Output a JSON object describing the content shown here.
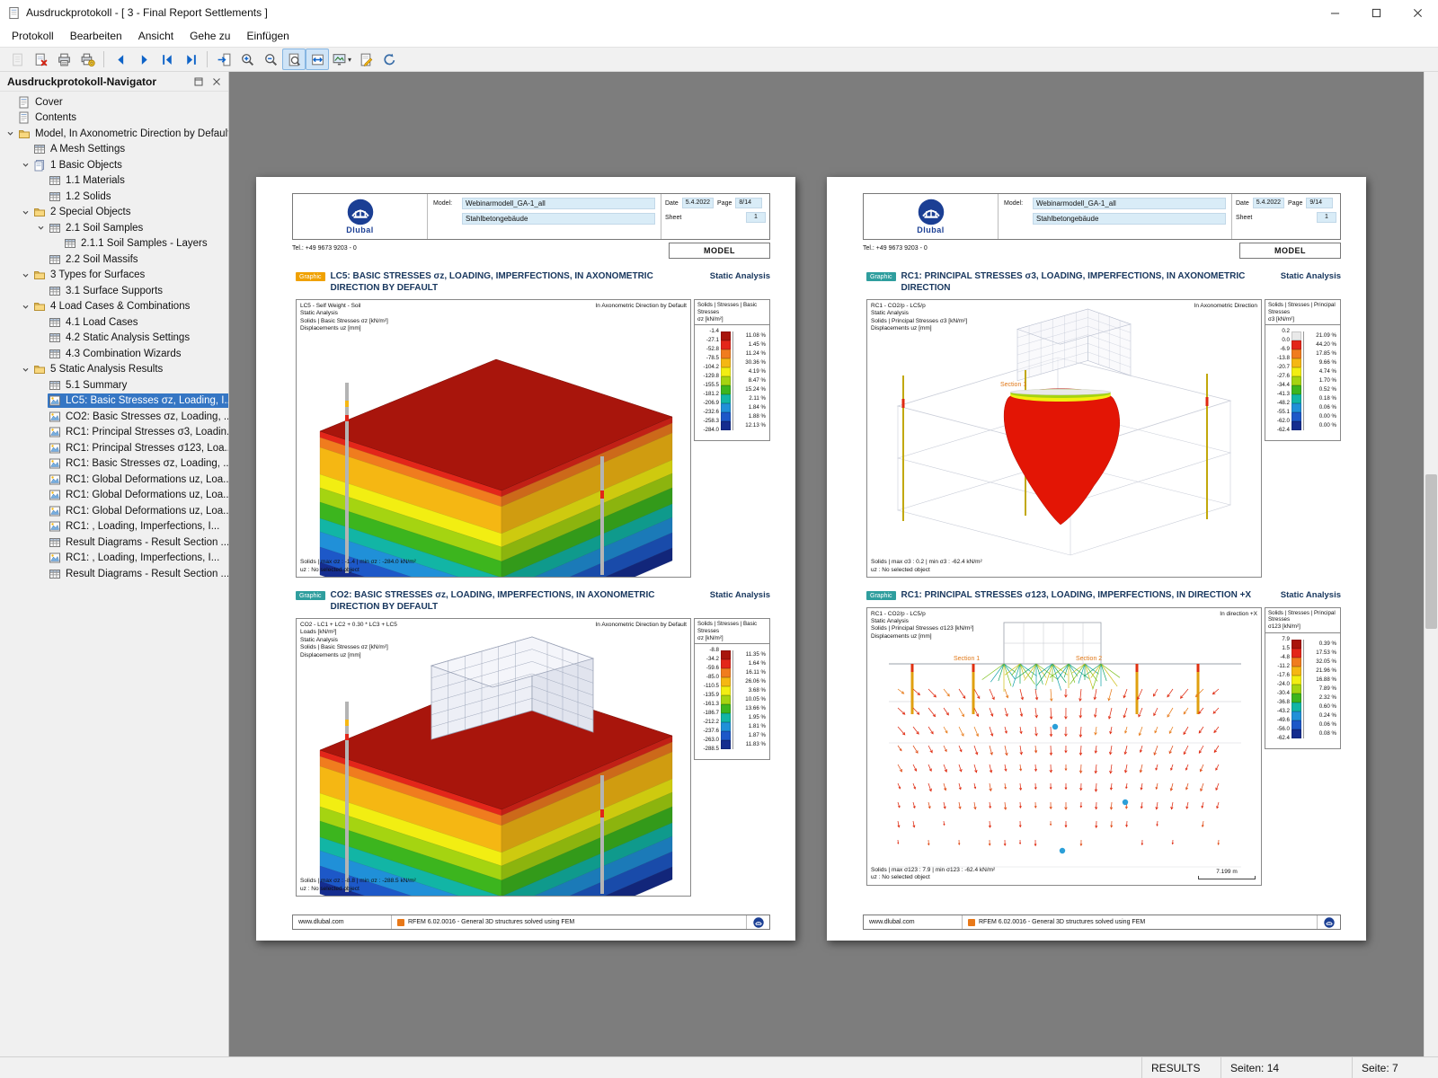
{
  "window": {
    "title": "Ausdruckprotokoll - [ 3 - Final Report Settlements ]"
  },
  "menu": [
    {
      "label": "Protokoll"
    },
    {
      "label": "Bearbeiten"
    },
    {
      "label": "Ansicht"
    },
    {
      "label": "Gehe zu"
    },
    {
      "label": "Einfügen"
    }
  ],
  "toolbar": [
    {
      "name": "new-page",
      "disabled": true
    },
    {
      "name": "delete-protocol"
    },
    {
      "name": "print"
    },
    {
      "name": "print-options"
    },
    {
      "name": "sep"
    },
    {
      "name": "nav-back"
    },
    {
      "name": "nav-forward"
    },
    {
      "name": "nav-first"
    },
    {
      "name": "nav-last"
    },
    {
      "name": "sep"
    },
    {
      "name": "goto-page"
    },
    {
      "name": "zoom-in"
    },
    {
      "name": "zoom-out"
    },
    {
      "name": "fit-page",
      "active": true
    },
    {
      "name": "fit-width",
      "active": true
    },
    {
      "name": "view-options",
      "dropdown": true
    },
    {
      "name": "edit-header"
    },
    {
      "name": "refresh"
    }
  ],
  "navigator": {
    "title": "Ausdruckprotokoll-Navigator",
    "items": [
      {
        "label": "Cover",
        "icon": "report",
        "level": 0
      },
      {
        "label": "Contents",
        "icon": "report",
        "level": 0
      },
      {
        "label": "Model, In Axonometric Direction by Default",
        "icon": "folder",
        "level": 0,
        "expanded": true
      },
      {
        "label": "A Mesh Settings",
        "icon": "table",
        "level": 1
      },
      {
        "label": "1 Basic Objects",
        "icon": "stack",
        "level": 1,
        "expanded": true
      },
      {
        "label": "1.1 Materials",
        "icon": "table",
        "level": 2
      },
      {
        "label": "1.2 Solids",
        "icon": "table",
        "level": 2
      },
      {
        "label": "2 Special Objects",
        "icon": "folder",
        "level": 1,
        "expanded": true
      },
      {
        "label": "2.1 Soil Samples",
        "icon": "table",
        "level": 2,
        "expanded": true
      },
      {
        "label": "2.1.1 Soil Samples - Layers",
        "icon": "table",
        "level": 3
      },
      {
        "label": "2.2 Soil Massifs",
        "icon": "table",
        "level": 2
      },
      {
        "label": "3 Types for Surfaces",
        "icon": "folder",
        "level": 1,
        "expanded": true
      },
      {
        "label": "3.1 Surface Supports",
        "icon": "table",
        "level": 2
      },
      {
        "label": "4 Load Cases & Combinations",
        "icon": "folder",
        "level": 1,
        "expanded": true
      },
      {
        "label": "4.1 Load Cases",
        "icon": "table",
        "level": 2
      },
      {
        "label": "4.2 Static Analysis Settings",
        "icon": "table",
        "level": 2
      },
      {
        "label": "4.3 Combination Wizards",
        "icon": "table",
        "level": 2
      },
      {
        "label": "5 Static Analysis Results",
        "icon": "folder",
        "level": 1,
        "expanded": true
      },
      {
        "label": "5.1 Summary",
        "icon": "table",
        "level": 2
      },
      {
        "label": "LC5: Basic Stresses σz, Loading, I...",
        "icon": "graphic",
        "level": 2,
        "selected": true
      },
      {
        "label": "CO2: Basic Stresses σz, Loading, ...",
        "icon": "graphic",
        "level": 2
      },
      {
        "label": "RC1: Principal Stresses σ3, Loadin...",
        "icon": "graphic",
        "level": 2
      },
      {
        "label": "RC1: Principal Stresses σ123, Loa...",
        "icon": "graphic",
        "level": 2
      },
      {
        "label": "RC1: Basic Stresses σz, Loading, ...",
        "icon": "graphic",
        "level": 2
      },
      {
        "label": "RC1: Global Deformations uz, Loa...",
        "icon": "graphic",
        "level": 2
      },
      {
        "label": "RC1: Global Deformations uz, Loa...",
        "icon": "graphic",
        "level": 2
      },
      {
        "label": "RC1: Global Deformations uz, Loa...",
        "icon": "graphic",
        "level": 2
      },
      {
        "label": "RC1: , Loading, Imperfections, I...",
        "icon": "graphic",
        "level": 2
      },
      {
        "label": "Result Diagrams - Result Section ...",
        "icon": "table",
        "level": 2
      },
      {
        "label": "RC1: , Loading, Imperfections, I...",
        "icon": "graphic",
        "level": 2
      },
      {
        "label": "Result Diagrams - Result Section ...",
        "icon": "table",
        "level": 2
      }
    ]
  },
  "preview": {
    "pages": [
      {
        "header": {
          "brand": "Dlubal",
          "model_label": "Model:",
          "model_name": "Webinarmodell_GA-1_all",
          "model_desc": "Stahlbetongebäude",
          "date_label": "Date",
          "date": "5.4.2022",
          "page_label": "Page",
          "page": "8/14",
          "sheet_label": "Sheet",
          "sheet": "1",
          "tel": "Tel.: +49 9673 9203 - 0",
          "doc_type": "MODEL"
        },
        "sections": [
          {
            "badge": "Graphic",
            "badge_color": "#f0a100",
            "title": "LC5: BASIC STRESSES σz, LOADING, IMPERFECTIONS, IN AXONOMETRIC DIRECTION BY DEFAULT",
            "analysis": "Static Analysis",
            "info": "LC5 - Self Weight - Soil\nStatic Analysis\nSolids | Basic Stresses σz [kN/m²]\nDisplacements uz [mm]",
            "view": "In Axonometric Direction by Default",
            "visual": "soil",
            "legend": {
              "title": "Solids | Stresses | Basic Stresses",
              "unit": "σz [kN/m²]",
              "values": [
                "-1.4",
                "-27.1",
                "-52.8",
                "-78.5",
                "-104.2",
                "-129.8",
                "-155.5",
                "-181.2",
                "-206.9",
                "-232.6",
                "-258.3",
                "-284.0"
              ],
              "percents": [
                "11.08 %",
                "1.45 %",
                "11.24 %",
                "30.36 %",
                "4.19 %",
                "8.47 %",
                "15.24 %",
                "2.11 %",
                "1.84 %",
                "1.88 %",
                "12.13 %"
              ],
              "colors": [
                "#a8150c",
                "#e3261a",
                "#f07c1e",
                "#f5b713",
                "#f2ee12",
                "#a5d411",
                "#3cb51e",
                "#12b5a5",
                "#2090d8",
                "#1d58c8",
                "#152d8f"
              ]
            },
            "result": "Solids | max σz : -1.4 | min σz : -284.0 kN/m²",
            "result2": "uz : No selected object"
          },
          {
            "badge": "Graphic",
            "badge_color": "#2f9e9e",
            "title": "CO2: BASIC STRESSES σz, LOADING, IMPERFECTIONS, IN AXONOMETRIC DIRECTION BY DEFAULT",
            "analysis": "Static Analysis",
            "info": "CO2 - LC1 + LC2 + 0.30 * LC3 + LC5\nLoads [kN/m²]\nStatic Analysis\nSolids | Basic Stresses σz [kN/m²]\nDisplacements uz [mm]",
            "view": "In Axonometric Direction by Default",
            "visual": "soil-building",
            "legend": {
              "title": "Solids | Stresses | Basic Stresses",
              "unit": "σz [kN/m²]",
              "values": [
                "-8.8",
                "-34.2",
                "-59.6",
                "-85.0",
                "-110.5",
                "-135.9",
                "-161.3",
                "-186.7",
                "-212.2",
                "-237.6",
                "-263.0",
                "-288.5"
              ],
              "percents": [
                "11.35 %",
                "1.64 %",
                "16.11 %",
                "26.06 %",
                "3.68 %",
                "10.05 %",
                "13.66 %",
                "1.95 %",
                "1.81 %",
                "1.87 %",
                "11.83 %"
              ],
              "colors": [
                "#a8150c",
                "#e3261a",
                "#f07c1e",
                "#f5b713",
                "#f2ee12",
                "#a5d411",
                "#3cb51e",
                "#12b5a5",
                "#2090d8",
                "#1d58c8",
                "#152d8f"
              ]
            },
            "result": "Solids | max σz : -8.8 | min σz : -288.5 kN/m²",
            "result2": "uz : No selected object"
          }
        ],
        "footer": {
          "url": "www.dlubal.com",
          "app": "RFEM 6.02.0016 - General 3D structures solved using FEM"
        }
      },
      {
        "header": {
          "brand": "Dlubal",
          "model_label": "Model:",
          "model_name": "Webinarmodell_GA-1_all",
          "model_desc": "Stahlbetongebäude",
          "date_label": "Date",
          "date": "5.4.2022",
          "page_label": "Page",
          "page": "9/14",
          "sheet_label": "Sheet",
          "sheet": "1",
          "tel": "Tel.: +49 9673 9203 - 0",
          "doc_type": "MODEL"
        },
        "sections": [
          {
            "badge": "Graphic",
            "badge_color": "#2f9e9e",
            "title": "RC1: PRINCIPAL STRESSES σ3, LOADING, IMPERFECTIONS, IN AXONOMETRIC DIRECTION",
            "analysis": "Static Analysis",
            "info": "RC1 - CO2/p - LC5/p\nStatic Analysis\nSolids | Principal Stresses σ3 [kN/m²]\nDisplacements uz [mm]",
            "view": "In Axonometric Direction",
            "visual": "blob",
            "annotations": [
              "Section 1"
            ],
            "legend": {
              "title": "Solids | Stresses | Principal Stresses",
              "unit": "σ3 [kN/m²]",
              "values": [
                "0.2",
                "0.0",
                "-6.9",
                "-13.8",
                "-20.7",
                "-27.6",
                "-34.4",
                "-41.3",
                "-48.2",
                "-55.1",
                "-62.0",
                "-62.4"
              ],
              "percents": [
                "21.09 %",
                "44.20 %",
                "17.85 %",
                "9.66 %",
                "4.74 %",
                "1.70 %",
                "0.52 %",
                "0.18 %",
                "0.06 %",
                "0.00 %",
                "0.00 %"
              ],
              "colors": [
                "#e9e9e9",
                "#e3261a",
                "#f07c1e",
                "#f5b713",
                "#f2ee12",
                "#a5d411",
                "#3cb51e",
                "#12b5a5",
                "#2090d8",
                "#1d58c8",
                "#152d8f"
              ]
            },
            "result": "Solids | max σ3 : 0.2 | min σ3 : -62.4 kN/m²",
            "result2": "uz : No selected object"
          },
          {
            "badge": "Graphic",
            "badge_color": "#2f9e9e",
            "title": "RC1: PRINCIPAL STRESSES σ123, LOADING, IMPERFECTIONS, IN DIRECTION +X",
            "analysis": "Static Analysis",
            "info": "RC1 - CO2/p - LC5/p\nStatic Analysis\nSolids | Principal Stresses σ123 [kN/m²]\nDisplacements uz [mm]",
            "view": "In direction +X",
            "visual": "vectors",
            "annotations": [
              "Section 1",
              "Section 2"
            ],
            "scale": "7.199 m",
            "legend": {
              "title": "Solids | Stresses | Principal Stresses",
              "unit": "σ123 [kN/m²]",
              "values": [
                "7.9",
                "1.5",
                "-4.8",
                "-11.2",
                "-17.6",
                "-24.0",
                "-30.4",
                "-36.8",
                "-43.2",
                "-49.6",
                "-56.0",
                "-62.4"
              ],
              "percents": [
                "0.39 %",
                "17.53 %",
                "32.05 %",
                "21.96 %",
                "16.88 %",
                "7.89 %",
                "2.32 %",
                "0.60 %",
                "0.24 %",
                "0.06 %",
                "0.08 %"
              ],
              "colors": [
                "#a8150c",
                "#e3261a",
                "#f07c1e",
                "#f5b713",
                "#f2ee12",
                "#a5d411",
                "#3cb51e",
                "#12b5a5",
                "#2090d8",
                "#1d58c8",
                "#152d8f"
              ]
            },
            "result": "Solids | max σ123 : 7.9 | min σ123 : -62.4 kN/m²",
            "result2": "uz : No selected object"
          }
        ],
        "footer": {
          "url": "www.dlubal.com",
          "app": "RFEM 6.02.0016 - General 3D structures solved using FEM"
        }
      }
    ]
  },
  "statusbar": {
    "results": "RESULTS",
    "total": "Seiten: 14",
    "current": "Seite: 7"
  }
}
